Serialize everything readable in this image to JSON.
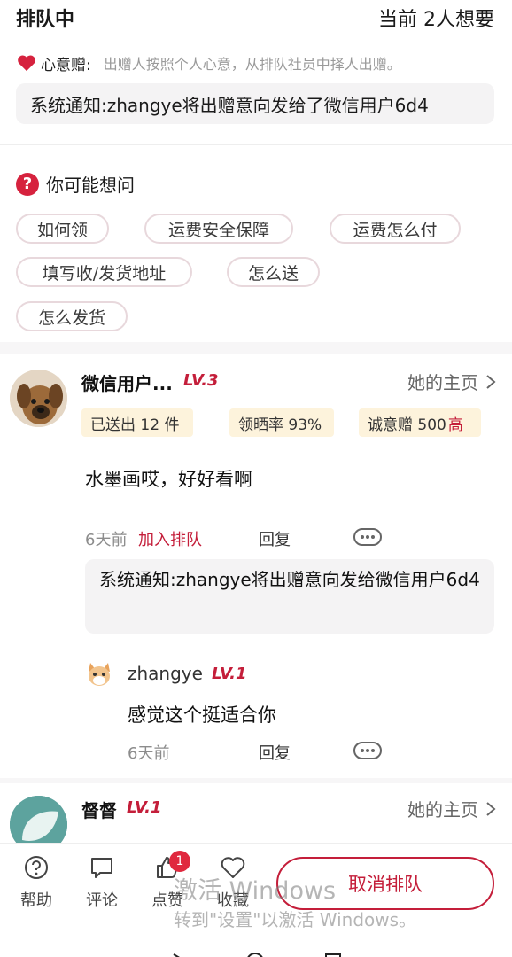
{
  "header": {
    "title": "排队中",
    "count_text": "当前 2人想要"
  },
  "intent": {
    "label": "心意赠:",
    "desc": "出赠人按照个人心意，从排队社员中择人出赠。"
  },
  "system_notice": "系统通知:zhangye将出赠意向发给了微信用户6d4",
  "faq": {
    "title": "你可能想问",
    "chips": [
      "如何领",
      "运费安全保障",
      "运费怎么付",
      "填写收/发货地址",
      "怎么送",
      "怎么发货"
    ]
  },
  "comments": [
    {
      "username": "微信用户...",
      "level": "LV.3",
      "home_link": "她的主页",
      "stats": {
        "sent": "已送出 12 件",
        "rate": "领晒率 93%",
        "sincerity_label": "诚意赠 500",
        "sincerity_flag": "高"
      },
      "text": "水墨画哎，好好看啊",
      "time": "6天前",
      "join_label": "加入排队",
      "reply_label": "回复",
      "system_reply": "系统通知:zhangye将出赠意向发给微信用户6d4",
      "sub_reply": {
        "username": "zhangye",
        "level": "LV.1",
        "text": "感觉这个挺适合你",
        "time": "6天前",
        "reply_label": "回复"
      }
    },
    {
      "username": "督督",
      "level": "LV.1",
      "home_link": "她的主页"
    }
  ],
  "bottom_bar": {
    "help": "帮助",
    "comment": "评论",
    "like": "点赞",
    "like_badge": "1",
    "favorite": "收藏",
    "cancel_button": "取消排队"
  },
  "watermark": {
    "line1": "激活 Windows",
    "line2": "转到\"设置\"以激活 Windows。"
  },
  "colors": {
    "accent": "#c41e3a",
    "stat_bg": "#fdf3dc",
    "notice_bg": "#f4f3f4"
  }
}
